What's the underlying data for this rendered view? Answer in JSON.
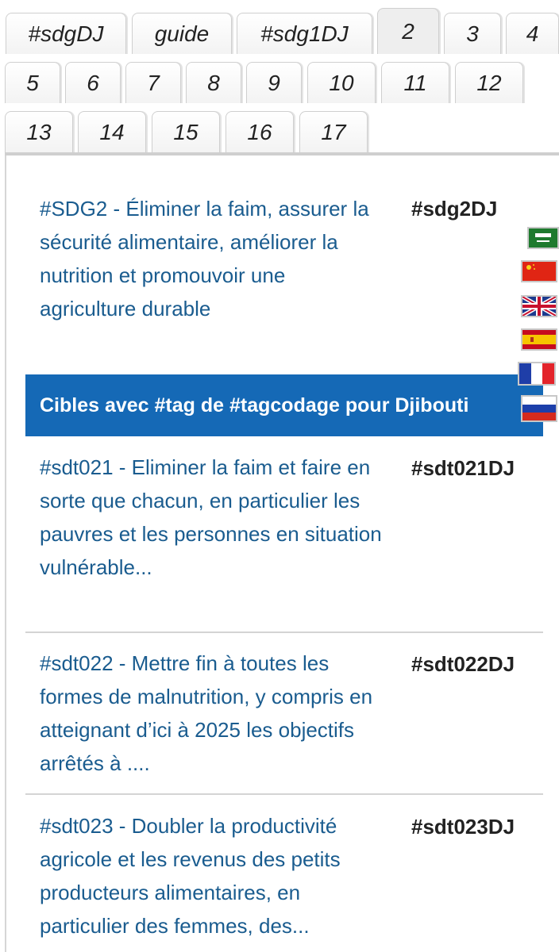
{
  "tabs": {
    "row1": [
      "#sdgDJ",
      "guide",
      "#sdg1DJ",
      "2",
      "3",
      "4"
    ],
    "row2": [
      "5",
      "6",
      "7",
      "8",
      "9",
      "10",
      "11",
      "12"
    ],
    "row3": [
      "13",
      "14",
      "15",
      "16",
      "17"
    ],
    "active": "2"
  },
  "goal": {
    "title": "#SDG2 - Éliminer la faim, assurer la sécurité alimentaire, améliorer la nutrition et promouvoir une agriculture durable",
    "tag": "#sdg2DJ"
  },
  "banner": "Cibles avec #tag de #tagcodage pour Djibouti",
  "flags": [
    "saudi-arabia-flag-icon",
    "china-flag-icon",
    "uk-flag-icon",
    "spain-flag-icon",
    "france-flag-icon",
    "russia-flag-icon"
  ],
  "targets": [
    {
      "text": "#sdt021 - Eliminer la faim et faire en sorte que chacun, en particulier les pauvres et les personnes en situation vulnérable...",
      "tag": "#sdt021DJ"
    },
    {
      "text": "#sdt022 - Mettre fin à toutes les formes de malnutrition, y compris en atteignant d’ici à 2025 les objectifs arrêtés à ....",
      "tag": "#sdt022DJ"
    },
    {
      "text": "#sdt023 - Doubler la productivité agricole et les revenus des petits producteurs alimentaires, en particulier des femmes, des...",
      "tag": "#sdt023DJ"
    }
  ],
  "colors": {
    "link": "#1a5c8f",
    "banner": "#1569b6"
  }
}
